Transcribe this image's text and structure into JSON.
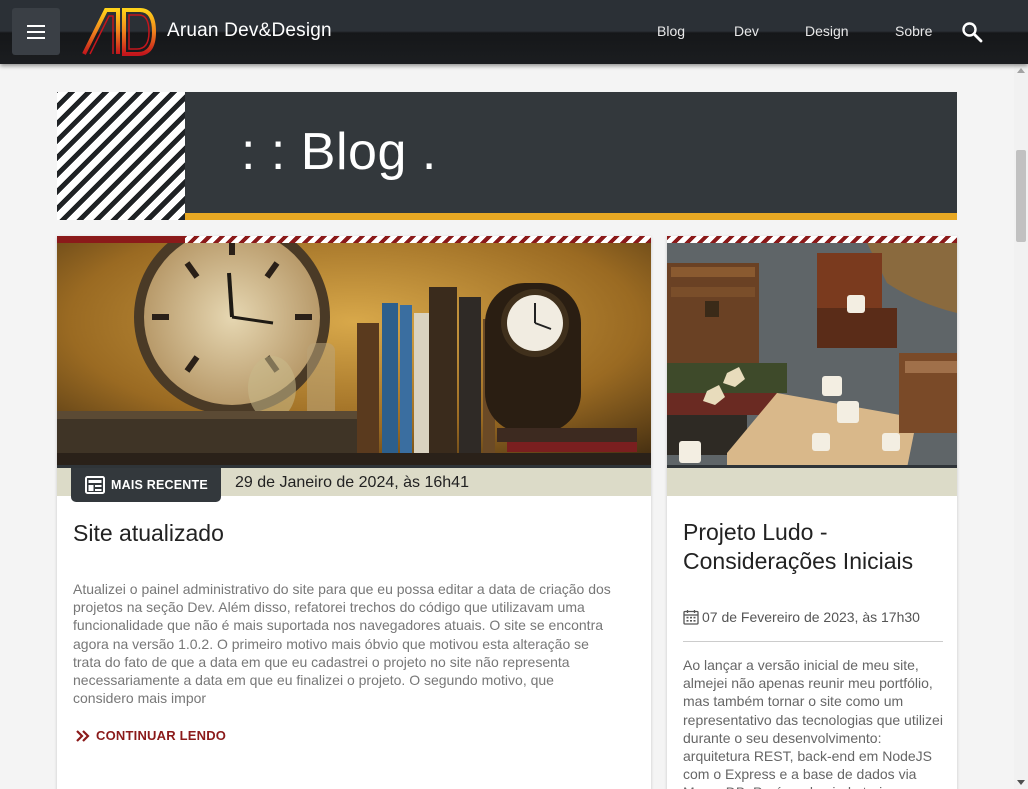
{
  "header": {
    "brand": "Aruan Dev&Design",
    "nav": [
      {
        "label": "Blog"
      },
      {
        "label": "Dev"
      },
      {
        "label": "Design"
      },
      {
        "label": "Sobre"
      }
    ]
  },
  "banner": {
    "title": ": : Blog ."
  },
  "posts": [
    {
      "badge": "MAIS RECENTE",
      "date": "29 de Janeiro de 2024, às 16h41",
      "title": "Site atualizado",
      "excerpt": "Atualizei o painel administrativo do site para que eu possa editar a data de criação dos projetos na seção Dev. Além disso, refatorei trechos do código que utilizavam uma funcionalidade que não é mais suportada nos navegadores atuais. O site se encontra agora na versão 1.0.2. O primeiro motivo mais óbvio que motivou esta alteração se trata do fato de que a data em que eu cadastrei o projeto no site não representa necessariamente a data em que eu finalizei o projeto. O segundo motivo, que considero mais impor",
      "read_more": "CONTINUAR LENDO"
    },
    {
      "title": "Projeto Ludo - Considerações Iniciais",
      "date": "07 de Fevereiro de 2023, às 17h30",
      "excerpt": "Ao lançar a versão inicial de meu site, almejei não apenas reunir meu portfólio, mas também tornar o site como um representativo das tecnologias que utilizei durante o seu desenvolvimento: arquitetura REST, back-end em NodeJS com o Express e a base de dados via MongoDB. Porém, ele ainda teria"
    }
  ],
  "colors": {
    "accent": "#8b1a1a",
    "banner_bg": "#33383c",
    "banner_underline": "#e8a823"
  }
}
